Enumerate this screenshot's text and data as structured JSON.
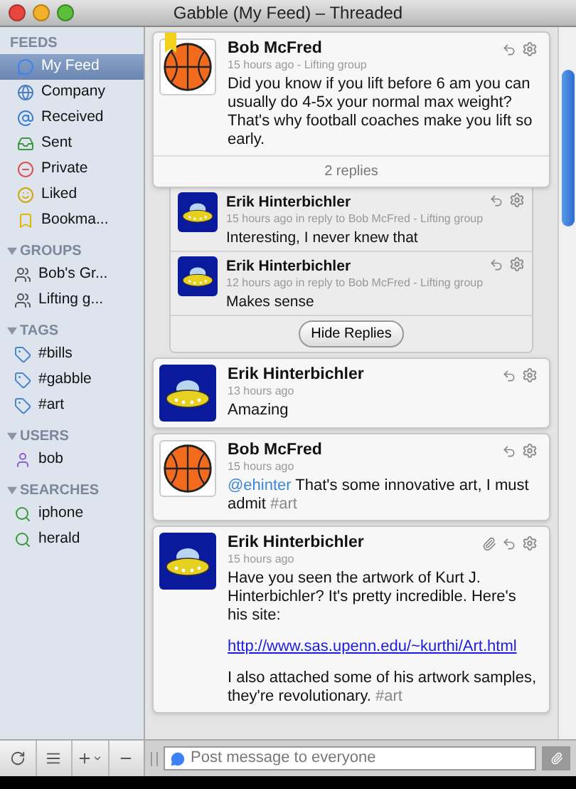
{
  "window": {
    "title": "Gabble (My Feed) – Threaded"
  },
  "sidebar": {
    "sections": [
      {
        "title": "FEEDS",
        "collapsible": false,
        "items": [
          {
            "label": "My Feed",
            "kind": "feed",
            "selected": true
          },
          {
            "label": "Company",
            "kind": "globe",
            "selected": false
          },
          {
            "label": "Received",
            "kind": "at",
            "selected": false
          },
          {
            "label": "Sent",
            "kind": "sent",
            "selected": false
          },
          {
            "label": "Private",
            "kind": "private",
            "selected": false
          },
          {
            "label": "Liked",
            "kind": "liked",
            "selected": false
          },
          {
            "label": "Bookma...",
            "kind": "bookmark",
            "selected": false
          }
        ]
      },
      {
        "title": "GROUPS",
        "collapsible": true,
        "items": [
          {
            "label": "Bob's Gr...",
            "kind": "group",
            "selected": false
          },
          {
            "label": "Lifting g...",
            "kind": "group",
            "selected": false
          }
        ]
      },
      {
        "title": "TAGS",
        "collapsible": true,
        "items": [
          {
            "label": "#bills",
            "kind": "tag",
            "selected": false
          },
          {
            "label": "#gabble",
            "kind": "tag",
            "selected": false
          },
          {
            "label": "#art",
            "kind": "tag",
            "selected": false
          }
        ]
      },
      {
        "title": "USERS",
        "collapsible": true,
        "items": [
          {
            "label": "bob",
            "kind": "user",
            "selected": false
          }
        ]
      },
      {
        "title": "SEARCHES",
        "collapsible": true,
        "items": [
          {
            "label": "iphone",
            "kind": "search",
            "selected": false
          },
          {
            "label": "herald",
            "kind": "search",
            "selected": false
          }
        ]
      }
    ]
  },
  "posts": [
    {
      "author": "Bob McFred",
      "meta": "15 hours ago - Lifting group",
      "avatar": {
        "kind": "ball"
      },
      "bookmarked": true,
      "attachment": false,
      "body": [
        [
          {
            "kind": "text",
            "text": "Did you know if you lift before 6 am you can usually do 4-5x your normal max weight? That's why football coaches make you lift so early."
          }
        ]
      ],
      "replies_label": "2 replies",
      "replies": [
        {
          "author": "Erik Hinterbichler",
          "meta": "15 hours ago in reply to Bob McFred - Lifting group",
          "avatar": {
            "kind": "ufo"
          },
          "body": [
            [
              {
                "kind": "text",
                "text": "Interesting, I never knew that"
              }
            ]
          ]
        },
        {
          "author": "Erik Hinterbichler",
          "meta": "12 hours ago in reply to Bob McFred - Lifting group",
          "avatar": {
            "kind": "ufo"
          },
          "body": [
            [
              {
                "kind": "text",
                "text": "Makes sense"
              }
            ]
          ]
        }
      ],
      "hide_button": "Hide Replies"
    },
    {
      "author": "Erik Hinterbichler",
      "meta": "13 hours ago",
      "avatar": {
        "kind": "ufo"
      },
      "bookmarked": false,
      "attachment": false,
      "body": [
        [
          {
            "kind": "text",
            "text": "Amazing"
          }
        ]
      ]
    },
    {
      "author": "Bob McFred",
      "meta": "15 hours ago",
      "avatar": {
        "kind": "ball"
      },
      "bookmarked": false,
      "attachment": false,
      "body": [
        [
          {
            "kind": "mention",
            "text": "@ehinter"
          },
          {
            "kind": "text",
            "text": " That's some innovative art, I must admit "
          },
          {
            "kind": "tag",
            "text": "#art"
          }
        ]
      ]
    },
    {
      "author": "Erik Hinterbichler",
      "meta": "15 hours ago",
      "avatar": {
        "kind": "ufo"
      },
      "bookmarked": false,
      "attachment": true,
      "body": [
        [
          {
            "kind": "text",
            "text": "Have you seen the artwork of Kurt J. Hinterbichler? It's pretty incredible. Here's his site:"
          }
        ],
        [
          {
            "kind": "link",
            "text": "http://www.sas.upenn.edu/~kurthi/Art.html"
          }
        ],
        [
          {
            "kind": "text",
            "text": "I also attached some of his artwork samples, they're revolutionary. "
          },
          {
            "kind": "tag",
            "text": "#art"
          }
        ]
      ]
    }
  ],
  "composer": {
    "placeholder": "Post message to everyone"
  }
}
